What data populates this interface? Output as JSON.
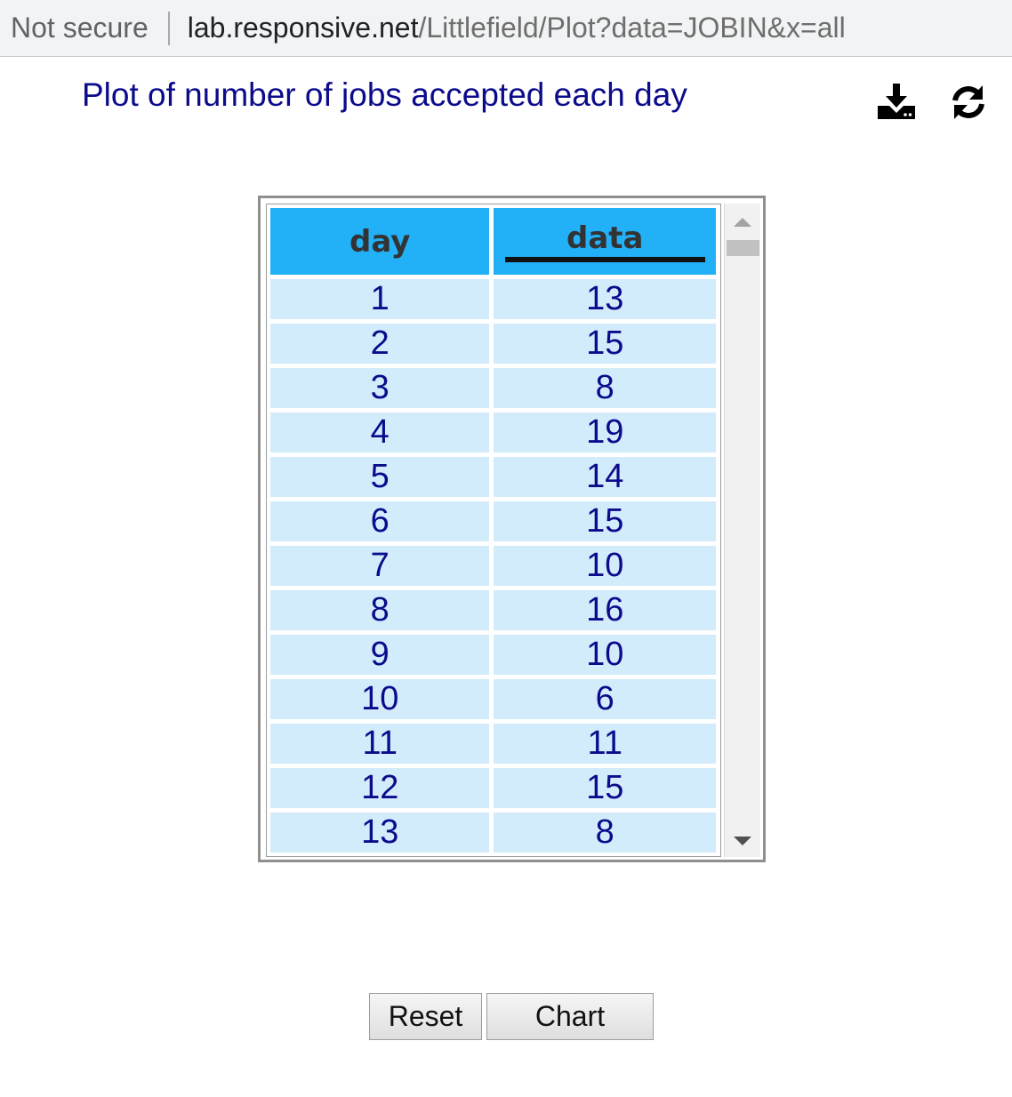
{
  "address_bar": {
    "security": "Not secure",
    "host": "lab.responsive.net",
    "path": "/Littlefield/Plot?data=JOBIN&x=all"
  },
  "page": {
    "title": "Plot of number of jobs accepted each day"
  },
  "toolbar": {
    "download_icon": "download-icon",
    "refresh_icon": "refresh-icon"
  },
  "table": {
    "columns": [
      "day",
      "data"
    ],
    "rows": [
      [
        "1",
        "13"
      ],
      [
        "2",
        "15"
      ],
      [
        "3",
        "8"
      ],
      [
        "4",
        "19"
      ],
      [
        "5",
        "14"
      ],
      [
        "6",
        "15"
      ],
      [
        "7",
        "10"
      ],
      [
        "8",
        "16"
      ],
      [
        "9",
        "10"
      ],
      [
        "10",
        "6"
      ],
      [
        "11",
        "11"
      ],
      [
        "12",
        "15"
      ],
      [
        "13",
        "8"
      ]
    ]
  },
  "buttons": {
    "reset": "Reset",
    "chart": "Chart"
  },
  "colors": {
    "header_bg": "#22b0f7",
    "cell_bg": "#d2ecfc",
    "text_navy": "#0b0b8c"
  }
}
